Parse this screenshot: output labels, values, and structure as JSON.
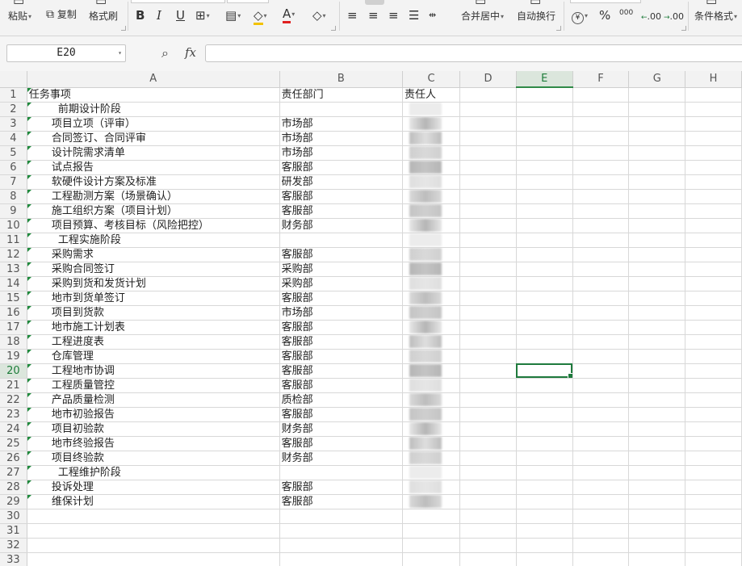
{
  "ribbon": {
    "paste": "粘贴",
    "copy": "复制",
    "format_painter": "格式刷",
    "merge_center": "合并居中",
    "wrap_text": "自动换行",
    "conditional_format": "条件格式",
    "bold": "B",
    "italic": "I",
    "underline": "U",
    "font_color_glyph": "A",
    "percent": "%",
    "thousands": "000",
    "inc_decimal": ".00",
    "dec_decimal": ".00",
    "currency": "¥"
  },
  "formula_bar": {
    "cell_ref": "E20",
    "fx": "fx",
    "formula": ""
  },
  "sheet": {
    "columns": [
      "A",
      "B",
      "C",
      "D",
      "E",
      "F",
      "G",
      "H"
    ],
    "selected_column": "E",
    "selected_row": 20,
    "rows": [
      {
        "n": "1",
        "a": "任务事项",
        "b": "责任部门",
        "c": "责任人",
        "style": "header"
      },
      {
        "n": "2",
        "a": "前期设计阶段",
        "b": "",
        "style": "section"
      },
      {
        "n": "3",
        "a": "项目立项（评审）",
        "b": "市场部",
        "style": "task"
      },
      {
        "n": "4",
        "a": "合同签订、合同评审",
        "b": "市场部",
        "style": "task"
      },
      {
        "n": "5",
        "a": "设计院需求清单",
        "b": "市场部",
        "style": "task"
      },
      {
        "n": "6",
        "a": "试点报告",
        "b": "客服部",
        "style": "task"
      },
      {
        "n": "7",
        "a": "软硬件设计方案及标准",
        "b": "研发部",
        "style": "task"
      },
      {
        "n": "8",
        "a": "工程勘测方案（场景确认）",
        "b": "客服部",
        "style": "task"
      },
      {
        "n": "9",
        "a": "施工组织方案（项目计划）",
        "b": "客服部",
        "style": "task"
      },
      {
        "n": "10",
        "a": "项目预算、考核目标（风险把控）",
        "b": "财务部",
        "style": "task"
      },
      {
        "n": "11",
        "a": "工程实施阶段",
        "b": "",
        "style": "section"
      },
      {
        "n": "12",
        "a": "采购需求",
        "b": "客服部",
        "style": "task"
      },
      {
        "n": "13",
        "a": "采购合同签订",
        "b": "采购部",
        "style": "task"
      },
      {
        "n": "14",
        "a": "采购到货和发货计划",
        "b": "采购部",
        "style": "task"
      },
      {
        "n": "15",
        "a": "地市到货单签订",
        "b": "客服部",
        "style": "task"
      },
      {
        "n": "16",
        "a": "项目到货款",
        "b": "市场部",
        "style": "task"
      },
      {
        "n": "17",
        "a": "地市施工计划表",
        "b": "客服部",
        "style": "task"
      },
      {
        "n": "18",
        "a": "工程进度表",
        "b": "客服部",
        "style": "task"
      },
      {
        "n": "19",
        "a": "仓库管理",
        "b": "客服部",
        "style": "task"
      },
      {
        "n": "20",
        "a": "工程地市协调",
        "b": "客服部",
        "style": "task"
      },
      {
        "n": "21",
        "a": "工程质量管控",
        "b": "客服部",
        "style": "task"
      },
      {
        "n": "22",
        "a": "产品质量检测",
        "b": "质检部",
        "style": "task"
      },
      {
        "n": "23",
        "a": "地市初验报告",
        "b": "客服部",
        "style": "task"
      },
      {
        "n": "24",
        "a": "项目初验款",
        "b": "财务部",
        "style": "task"
      },
      {
        "n": "25",
        "a": "地市终验报告",
        "b": "客服部",
        "style": "task"
      },
      {
        "n": "26",
        "a": "项目终验款",
        "b": "财务部",
        "style": "task"
      },
      {
        "n": "27",
        "a": "工程维护阶段",
        "b": "",
        "style": "section"
      },
      {
        "n": "28",
        "a": "投诉处理",
        "b": "客服部",
        "style": "task"
      },
      {
        "n": "29",
        "a": "维保计划",
        "b": "客服部",
        "style": "task"
      },
      {
        "n": "30",
        "a": "",
        "b": "",
        "style": "empty"
      },
      {
        "n": "31",
        "a": "",
        "b": "",
        "style": "empty"
      },
      {
        "n": "32",
        "a": "",
        "b": "",
        "style": "empty"
      },
      {
        "n": "33",
        "a": "",
        "b": "",
        "style": "empty"
      }
    ]
  },
  "colors": {
    "accent_green": "#1f7a3d",
    "header_bg": "#f2f2f2",
    "grid_line": "#d8d8d8"
  }
}
